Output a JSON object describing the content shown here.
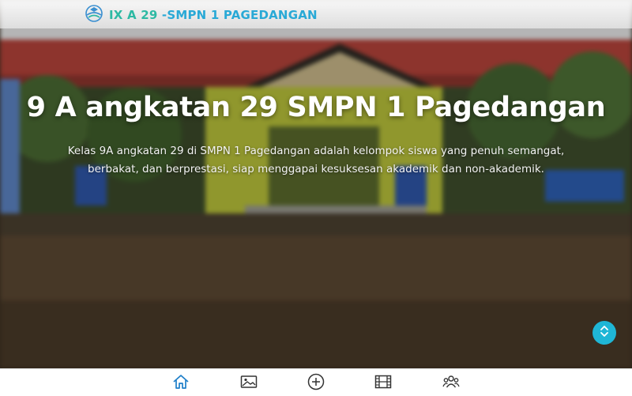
{
  "header": {
    "brand_part1": "IX A 29",
    "brand_part2": " -SMPN 1 PAGEDANGAN",
    "logo_icon": "book-graduation-logo-icon"
  },
  "hero": {
    "title": "9 A angkatan 29 SMPN 1 Pagedangan",
    "description": "Kelas 9A angkatan 29 di SMPN 1 Pagedangan adalah kelompok siswa yang penuh semangat, berbakat, dan berprestasi, siap menggapai kesuksesan akademik dan non-akademik."
  },
  "scroll_button": {
    "icon": "chevron-up-down-icon"
  },
  "bottom_nav": {
    "items": [
      {
        "icon": "home-icon"
      },
      {
        "icon": "image-icon"
      },
      {
        "icon": "add-circle-icon"
      },
      {
        "icon": "film-icon"
      },
      {
        "icon": "group-icon"
      }
    ],
    "active": "home-icon"
  },
  "colors": {
    "brand_primary": "#29a9d6",
    "brand_secondary": "#2db9a3",
    "active_nav": "#1f7fc9",
    "inactive_nav": "#333333",
    "scroll_button": "#1fb6d6"
  }
}
